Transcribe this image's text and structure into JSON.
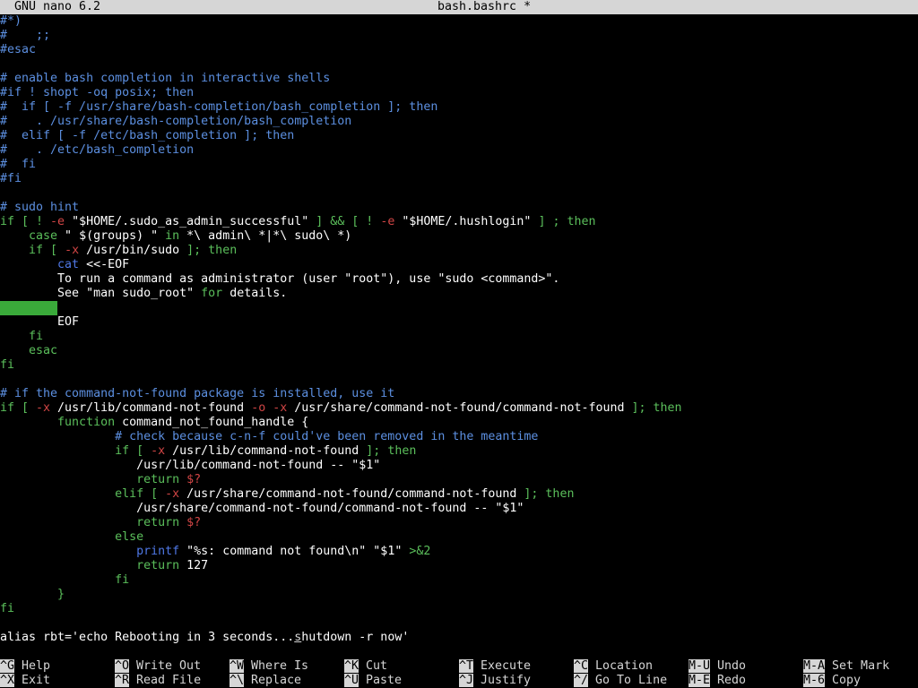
{
  "title": {
    "app": "GNU nano 6.2",
    "file": "bash.bashrc *"
  },
  "lines": [
    [
      {
        "t": "#*)",
        "c": "c"
      }
    ],
    [
      {
        "t": "#    ;;",
        "c": "c"
      }
    ],
    [
      {
        "t": "#esac",
        "c": "c"
      }
    ],
    [],
    [
      {
        "t": "# enable bash completion in interactive shells",
        "c": "c"
      }
    ],
    [
      {
        "t": "#if ! shopt -oq posix; then",
        "c": "c"
      }
    ],
    [
      {
        "t": "#  if [ -f /usr/share/bash-completion/bash_completion ]; then",
        "c": "c"
      }
    ],
    [
      {
        "t": "#    . /usr/share/bash-completion/bash_completion",
        "c": "c"
      }
    ],
    [
      {
        "t": "#  elif [ -f /etc/bash_completion ]; then",
        "c": "c"
      }
    ],
    [
      {
        "t": "#    . /etc/bash_completion",
        "c": "c"
      }
    ],
    [
      {
        "t": "#  fi",
        "c": "c"
      }
    ],
    [
      {
        "t": "#fi",
        "c": "c"
      }
    ],
    [],
    [
      {
        "t": "# sudo hint",
        "c": "c"
      }
    ],
    [
      {
        "t": "if [ ! ",
        "c": "k"
      },
      {
        "t": "-e",
        "c": "r"
      },
      {
        "t": " \"$HOME/.sudo_as_admin_successful\"",
        "c": "s"
      },
      {
        "t": " ] && [ ! ",
        "c": "k"
      },
      {
        "t": "-e",
        "c": "r"
      },
      {
        "t": " \"$HOME/.hushlogin\"",
        "c": "s"
      },
      {
        "t": " ] ; then",
        "c": "k"
      }
    ],
    [
      {
        "t": "    case",
        "c": "k"
      },
      {
        "t": " \" $(groups) \"",
        "c": "s"
      },
      {
        "t": " in",
        "c": "k"
      },
      {
        "t": " *\\ admin\\ *|*\\ sudo\\ *)",
        "c": "s"
      }
    ],
    [
      {
        "t": "    if [ ",
        "c": "k"
      },
      {
        "t": "-x",
        "c": "r"
      },
      {
        "t": " /usr/bin/sudo",
        "c": "s"
      },
      {
        "t": " ]; then",
        "c": "k"
      }
    ],
    [
      {
        "t": "        ",
        "c": "s"
      },
      {
        "t": "cat",
        "c": "b"
      },
      {
        "t": " <<-EOF",
        "c": "s"
      }
    ],
    [
      {
        "t": "        To run a command as administrator (user \"root\"), use \"sudo <command>\".",
        "c": "s"
      }
    ],
    [
      {
        "t": "        See \"man sudo_root\" ",
        "c": "s"
      },
      {
        "t": "for",
        "c": "k"
      },
      {
        "t": " details.",
        "c": "s"
      }
    ],
    [
      {
        "t": "",
        "c": "hl"
      }
    ],
    [
      {
        "t": "        EOF",
        "c": "s"
      }
    ],
    [
      {
        "t": "    fi",
        "c": "k"
      }
    ],
    [
      {
        "t": "    esac",
        "c": "k"
      }
    ],
    [
      {
        "t": "fi",
        "c": "k"
      }
    ],
    [],
    [
      {
        "t": "# if the command-not-found package is installed, use it",
        "c": "c"
      }
    ],
    [
      {
        "t": "if [ ",
        "c": "k"
      },
      {
        "t": "-x",
        "c": "r"
      },
      {
        "t": " /usr/lib/command-not-found ",
        "c": "s"
      },
      {
        "t": "-o",
        "c": "r"
      },
      {
        "t": " ",
        "c": "s"
      },
      {
        "t": "-x",
        "c": "r"
      },
      {
        "t": " /usr/share/command-not-found/command-not-found",
        "c": "s"
      },
      {
        "t": " ]; then",
        "c": "k"
      }
    ],
    [
      {
        "t": "        function",
        "c": "k"
      },
      {
        "t": " command_not_found_handle {",
        "c": "s"
      }
    ],
    [
      {
        "t": "                # check because c-n-f could've been removed in the meantime",
        "c": "c"
      }
    ],
    [
      {
        "t": "                if [ ",
        "c": "k"
      },
      {
        "t": "-x",
        "c": "r"
      },
      {
        "t": " /usr/lib/command-not-found",
        "c": "s"
      },
      {
        "t": " ]; then",
        "c": "k"
      }
    ],
    [
      {
        "t": "                   /usr/lib/command-not-found -- \"$1\"",
        "c": "s"
      }
    ],
    [
      {
        "t": "                   return",
        "c": "k"
      },
      {
        "t": " $?",
        "c": "r"
      }
    ],
    [
      {
        "t": "                elif [ ",
        "c": "k"
      },
      {
        "t": "-x",
        "c": "r"
      },
      {
        "t": " /usr/share/command-not-found/command-not-found",
        "c": "s"
      },
      {
        "t": " ]; then",
        "c": "k"
      }
    ],
    [
      {
        "t": "                   /usr/share/command-not-found/command-not-found -- \"$1\"",
        "c": "s"
      }
    ],
    [
      {
        "t": "                   return",
        "c": "k"
      },
      {
        "t": " $?",
        "c": "r"
      }
    ],
    [
      {
        "t": "                else",
        "c": "k"
      }
    ],
    [
      {
        "t": "                   ",
        "c": "s"
      },
      {
        "t": "printf",
        "c": "b"
      },
      {
        "t": " \"%s: command not found\\n\" \"$1\"",
        "c": "s"
      },
      {
        "t": " >&2",
        "c": "k"
      }
    ],
    [
      {
        "t": "                   return",
        "c": "k"
      },
      {
        "t": " 127",
        "c": "s"
      }
    ],
    [
      {
        "t": "                fi",
        "c": "k"
      }
    ],
    [
      {
        "t": "        }",
        "c": "k"
      }
    ],
    [
      {
        "t": "fi",
        "c": "k"
      }
    ],
    [],
    [
      {
        "t": "alias rbt='echo Rebooting in 3 seconds...",
        "c": "s"
      },
      {
        "t": "s",
        "c": "u"
      },
      {
        "t": "hutdown -r now'",
        "c": "s"
      }
    ]
  ],
  "shortcuts": {
    "row1": [
      {
        "key": "^G",
        "label": "Help"
      },
      {
        "key": "^O",
        "label": "Write Out"
      },
      {
        "key": "^W",
        "label": "Where Is"
      },
      {
        "key": "^K",
        "label": "Cut"
      },
      {
        "key": "^T",
        "label": "Execute"
      },
      {
        "key": "^C",
        "label": "Location"
      },
      {
        "key": "M-U",
        "label": "Undo"
      },
      {
        "key": "M-A",
        "label": "Set Mark"
      }
    ],
    "row2": [
      {
        "key": "^X",
        "label": "Exit"
      },
      {
        "key": "^R",
        "label": "Read File"
      },
      {
        "key": "^\\",
        "label": "Replace"
      },
      {
        "key": "^U",
        "label": "Paste"
      },
      {
        "key": "^J",
        "label": "Justify"
      },
      {
        "key": "^/",
        "label": "Go To Line"
      },
      {
        "key": "M-E",
        "label": "Redo"
      },
      {
        "key": "M-6",
        "label": "Copy"
      }
    ]
  },
  "colors": {
    "background": "#000000",
    "titlebar": "#d6d6d6",
    "comment": "#5c8fe0",
    "keyword": "#5bbf5b",
    "flag": "#d04545",
    "builtin": "#4f78e6",
    "cursor_line": "#3aaa3a"
  }
}
